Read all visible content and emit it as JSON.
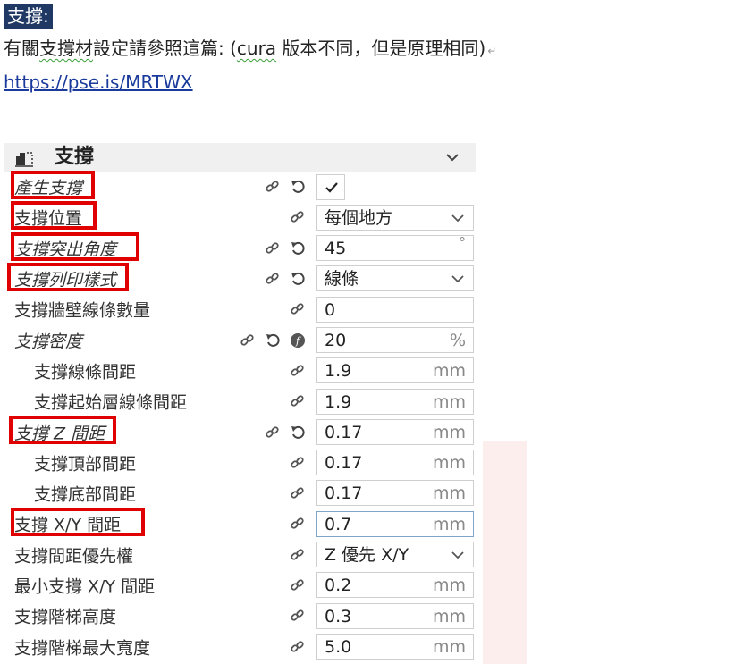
{
  "doc": {
    "heading": "支撐:",
    "line_before": "有關",
    "line_wavy": "支撐材",
    "line_after_wavy": "設定請參照這篇: (",
    "line_cura": "cura",
    "line_rest": " 版本不同，但是原理相同)",
    "link": "https://pse.is/MRTWX"
  },
  "panel": {
    "title": "支撐",
    "rows": [
      {
        "label": "產生支撐",
        "checked": true
      },
      {
        "label": "支撐位置",
        "value": "每個地方"
      },
      {
        "label": "支撐突出角度",
        "value": "45",
        "unit": "°"
      },
      {
        "label": "支撐列印樣式",
        "value": "線條"
      },
      {
        "label": "支撐牆壁線條數量",
        "value": "0"
      },
      {
        "label": "支撐密度",
        "value": "20",
        "unit": "%"
      },
      {
        "label": "支撐線條間距",
        "value": "1.9",
        "unit": "mm"
      },
      {
        "label": "支撐起始層線條間距",
        "value": "1.9",
        "unit": "mm"
      },
      {
        "label": "支撐 Z 間距",
        "value": "0.17",
        "unit": "mm"
      },
      {
        "label": "支撐頂部間距",
        "value": "0.17",
        "unit": "mm"
      },
      {
        "label": "支撐底部間距",
        "value": "0.17",
        "unit": "mm"
      },
      {
        "label": "支撐 X/Y 間距",
        "value": "0.7",
        "unit": "mm"
      },
      {
        "label": "支撐間距優先權",
        "value": "Z 優先 X/Y"
      },
      {
        "label": "最小支撐 X/Y 間距",
        "value": "0.2",
        "unit": "mm"
      },
      {
        "label": "支撐階梯高度",
        "value": "0.3",
        "unit": "mm"
      },
      {
        "label": "支撐階梯最大寬度",
        "value": "5.0",
        "unit": "mm"
      }
    ]
  },
  "colors": {
    "highlight": "#e00000",
    "heading_bg": "#1f3864",
    "link": "#1a3a9c"
  }
}
